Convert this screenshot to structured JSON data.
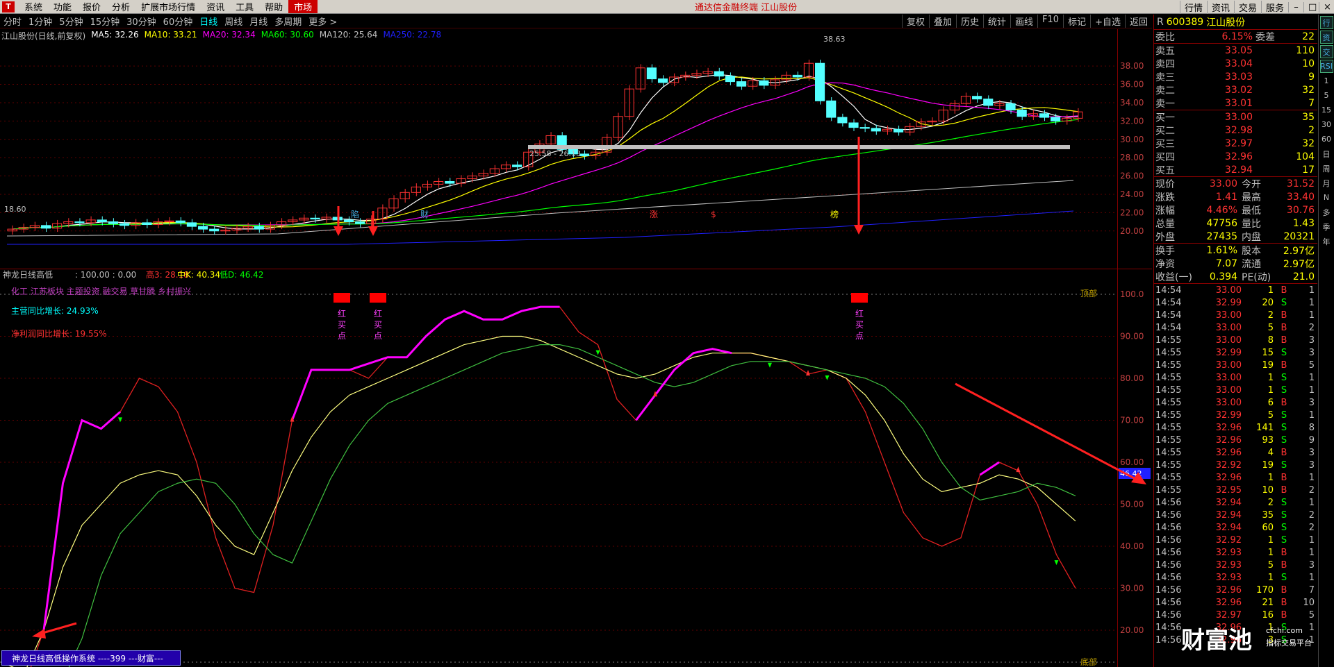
{
  "menubar": {
    "logo": "T",
    "items": [
      "系统",
      "功能",
      "报价",
      "分析",
      "扩展市场行情",
      "资讯",
      "工具",
      "帮助"
    ],
    "active": "市场",
    "center_title": "通达信金融终端  江山股份",
    "right_buttons": [
      "行情",
      "资讯",
      "交易",
      "服务"
    ]
  },
  "timeframes": [
    "分时",
    "1分钟",
    "5分钟",
    "15分钟",
    "30分钟",
    "60分钟",
    "日线",
    "周线",
    "月线",
    "多周期",
    "更多 >"
  ],
  "active_timeframe": "日线",
  "tools": [
    "复权",
    "叠加",
    "历史",
    "统计",
    "画线",
    "F10",
    "标记",
    "+自选",
    "返回"
  ],
  "legend": {
    "title": "江山股份(日线,前复权)",
    "ma5": "MA5: 32.26",
    "ma10": "MA10: 33.21",
    "ma20": "MA20: 32.34",
    "ma60": "MA60: 30.60",
    "ma120": "MA120: 25.64",
    "ma250": "MA250: 22.78"
  },
  "colors": {
    "ma5": "#ffffff",
    "ma10": "#ffff00",
    "ma20": "#ff00ff",
    "ma60": "#00ff00",
    "ma120": "#c0c0c0",
    "ma250": "#2020ff",
    "up": "#ff3232",
    "down": "#54ffff"
  },
  "price_axis": [
    "38.00",
    "36.00",
    "34.00",
    "32.00",
    "30.00",
    "28.00",
    "26.00",
    "24.00",
    "22.00",
    "20.00"
  ],
  "price_annotations": {
    "high": "38.63",
    "low": "18.60",
    "range": "25.58 - 26.13"
  },
  "event_markers": [
    "陷",
    "财",
    "涨",
    "$",
    "榜"
  ],
  "sub": {
    "title": "神龙日线高低",
    "values": ": 100.00 : 0.00",
    "high_label": "高3: 28.18",
    "mid_label": "中K: 40.34",
    "low_label": "低D: 46.42",
    "themes": "化工 江苏板块 主题投资 融交易 草甘膦 乡村振兴",
    "revenue_growth": "主营同比增长: 24.93%",
    "profit_growth": "净利润同比增长: 19.55%",
    "top_label": "顶部",
    "bottom_label": "底部",
    "buy_label_chars": [
      "红",
      "买",
      "点"
    ],
    "axis": [
      "100.0",
      "90.00",
      "80.00",
      "70.00",
      "60.00",
      "50.00",
      "40.00",
      "30.00",
      "20.00"
    ],
    "current_value": "46.42"
  },
  "bottombar_label": "神龙日线高低操作系统 ----399 ---财富---",
  "quote": {
    "code": "600389",
    "name": "江山股份",
    "weibi_label": "委比",
    "weibi": "6.15%",
    "weicha_label": "委差",
    "weicha": "22",
    "asks": [
      {
        "label": "卖五",
        "price": "33.05",
        "vol": "110"
      },
      {
        "label": "卖四",
        "price": "33.04",
        "vol": "10"
      },
      {
        "label": "卖三",
        "price": "33.03",
        "vol": "9"
      },
      {
        "label": "卖二",
        "price": "33.02",
        "vol": "32"
      },
      {
        "label": "卖一",
        "price": "33.01",
        "vol": "7"
      }
    ],
    "bids": [
      {
        "label": "买一",
        "price": "33.00",
        "vol": "35"
      },
      {
        "label": "买二",
        "price": "32.98",
        "vol": "2"
      },
      {
        "label": "买三",
        "price": "32.97",
        "vol": "32"
      },
      {
        "label": "买四",
        "price": "32.96",
        "vol": "104"
      },
      {
        "label": "买五",
        "price": "32.94",
        "vol": "17"
      }
    ],
    "stats": [
      {
        "k": "现价",
        "v": "33.00",
        "k2": "今开",
        "v2": "31.52"
      },
      {
        "k": "涨跌",
        "v": "1.41",
        "k2": "最高",
        "v2": "33.40"
      },
      {
        "k": "涨幅",
        "v": "4.46%",
        "k2": "最低",
        "v2": "30.76"
      },
      {
        "k": "总量",
        "v": "47756",
        "k2": "量比",
        "v2": "1.43"
      },
      {
        "k": "外盘",
        "v": "27435",
        "k2": "内盘",
        "v2": "20321"
      }
    ],
    "stats2": [
      {
        "k": "换手",
        "v": "1.61%",
        "k2": "股本",
        "v2": "2.97亿"
      },
      {
        "k": "净资",
        "v": "7.07",
        "k2": "流通",
        "v2": "2.97亿"
      },
      {
        "k": "收益(一)",
        "v": "0.394",
        "k2": "PE(动)",
        "v2": "21.0"
      }
    ],
    "ticks": [
      {
        "t": "14:54",
        "p": "33.00",
        "v": "1",
        "bs": "B",
        "n": "1"
      },
      {
        "t": "14:54",
        "p": "32.99",
        "v": "20",
        "bs": "S",
        "n": "1"
      },
      {
        "t": "14:54",
        "p": "33.00",
        "v": "2",
        "bs": "B",
        "n": "1"
      },
      {
        "t": "14:54",
        "p": "33.00",
        "v": "5",
        "bs": "B",
        "n": "2"
      },
      {
        "t": "14:55",
        "p": "33.00",
        "v": "8",
        "bs": "B",
        "n": "3"
      },
      {
        "t": "14:55",
        "p": "32.99",
        "v": "15",
        "bs": "S",
        "n": "3"
      },
      {
        "t": "14:55",
        "p": "33.00",
        "v": "19",
        "bs": "B",
        "n": "5"
      },
      {
        "t": "14:55",
        "p": "33.00",
        "v": "1",
        "bs": "S",
        "n": "1"
      },
      {
        "t": "14:55",
        "p": "33.00",
        "v": "1",
        "bs": "S",
        "n": "1"
      },
      {
        "t": "14:55",
        "p": "33.00",
        "v": "6",
        "bs": "B",
        "n": "3"
      },
      {
        "t": "14:55",
        "p": "32.99",
        "v": "5",
        "bs": "S",
        "n": "1"
      },
      {
        "t": "14:55",
        "p": "32.96",
        "v": "141",
        "bs": "S",
        "n": "8"
      },
      {
        "t": "14:55",
        "p": "32.96",
        "v": "93",
        "bs": "S",
        "n": "9"
      },
      {
        "t": "14:55",
        "p": "32.96",
        "v": "4",
        "bs": "B",
        "n": "3"
      },
      {
        "t": "14:55",
        "p": "32.92",
        "v": "19",
        "bs": "S",
        "n": "3"
      },
      {
        "t": "14:55",
        "p": "32.96",
        "v": "1",
        "bs": "B",
        "n": "1"
      },
      {
        "t": "14:55",
        "p": "32.95",
        "v": "10",
        "bs": "B",
        "n": "2"
      },
      {
        "t": "14:56",
        "p": "32.94",
        "v": "2",
        "bs": "S",
        "n": "1"
      },
      {
        "t": "14:56",
        "p": "32.94",
        "v": "35",
        "bs": "S",
        "n": "2"
      },
      {
        "t": "14:56",
        "p": "32.94",
        "v": "60",
        "bs": "S",
        "n": "2"
      },
      {
        "t": "14:56",
        "p": "32.92",
        "v": "1",
        "bs": "S",
        "n": "1"
      },
      {
        "t": "14:56",
        "p": "32.93",
        "v": "1",
        "bs": "B",
        "n": "1"
      },
      {
        "t": "14:56",
        "p": "32.93",
        "v": "5",
        "bs": "B",
        "n": "3"
      },
      {
        "t": "14:56",
        "p": "32.93",
        "v": "1",
        "bs": "S",
        "n": "1"
      },
      {
        "t": "14:56",
        "p": "32.96",
        "v": "170",
        "bs": "B",
        "n": "7"
      },
      {
        "t": "14:56",
        "p": "32.96",
        "v": "21",
        "bs": "B",
        "n": "10"
      },
      {
        "t": "14:56",
        "p": "32.97",
        "v": "16",
        "bs": "B",
        "n": "5"
      },
      {
        "t": "14:56",
        "p": "32.96",
        "v": "1",
        "bs": "S",
        "n": "1"
      },
      {
        "t": "14:56",
        "p": "32.96",
        "v": "3",
        "bs": "S",
        "n": "1"
      }
    ]
  },
  "sidebar": [
    "行",
    "资",
    "交",
    "RSI",
    "1",
    "5",
    "15",
    "30",
    "60",
    "日",
    "周",
    "月",
    "N",
    "多",
    "季",
    "年"
  ],
  "watermark": {
    "main": "财富池",
    "site": "cfchi.com",
    "sub": "指标交易平台"
  }
}
